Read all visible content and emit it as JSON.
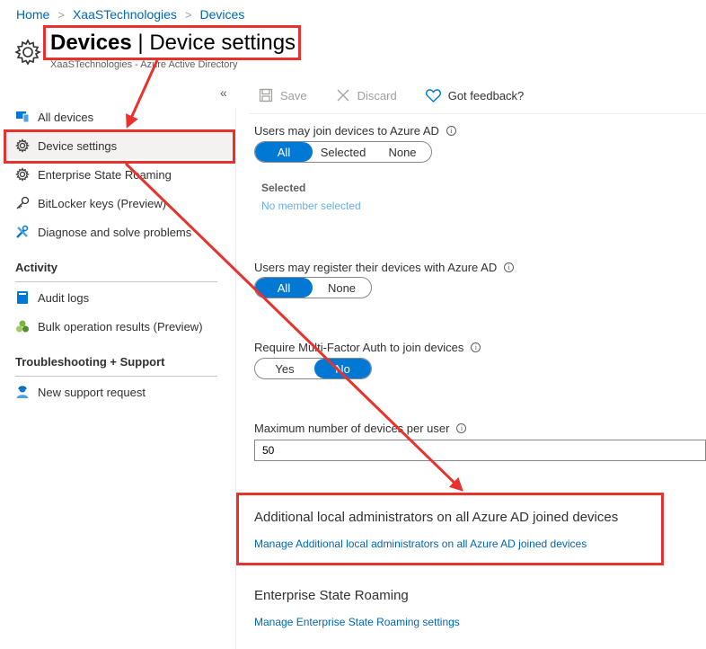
{
  "breadcrumb": {
    "home": "Home",
    "org": "XaaSTechnologies",
    "current": "Devices"
  },
  "header": {
    "title_bold": "Devices",
    "title_rest": " | Device settings",
    "subtitle": "XaaSTechnologies - Azure Active Directory"
  },
  "sidebar": {
    "collapse_glyph": "«",
    "items": [
      {
        "label": "All devices"
      },
      {
        "label": "Device settings"
      },
      {
        "label": "Enterprise State Roaming"
      },
      {
        "label": "BitLocker keys (Preview)"
      },
      {
        "label": "Diagnose and solve problems"
      }
    ],
    "activity_title": "Activity",
    "activity_items": [
      {
        "label": "Audit logs"
      },
      {
        "label": "Bulk operation results (Preview)"
      }
    ],
    "support_title": "Troubleshooting + Support",
    "support_items": [
      {
        "label": "New support request"
      }
    ]
  },
  "toolbar": {
    "save": "Save",
    "discard": "Discard",
    "feedback": "Got feedback?"
  },
  "settings": {
    "join": {
      "label": "Users may join devices to Azure AD",
      "options": [
        "All",
        "Selected",
        "None"
      ],
      "selected": "All"
    },
    "selected_group": {
      "label": "Selected",
      "value": "No member selected"
    },
    "register": {
      "label": "Users may register their devices with Azure AD",
      "options": [
        "All",
        "None"
      ],
      "selected": "All"
    },
    "mfa": {
      "label": "Require Multi-Factor Auth to join devices",
      "options": [
        "Yes",
        "No"
      ],
      "selected": "No"
    },
    "max_devices": {
      "label": "Maximum number of devices per user",
      "value": "50"
    }
  },
  "sections": {
    "local_admins": {
      "title": "Additional local administrators on all Azure AD joined devices",
      "link": "Manage Additional local administrators on all Azure AD joined devices"
    },
    "esr": {
      "title": "Enterprise State Roaming",
      "link": "Manage Enterprise State Roaming settings"
    }
  },
  "info_glyph": "i",
  "colors": {
    "accent": "#0078d4",
    "link": "#0067b8",
    "annotation": "#e8322d"
  }
}
